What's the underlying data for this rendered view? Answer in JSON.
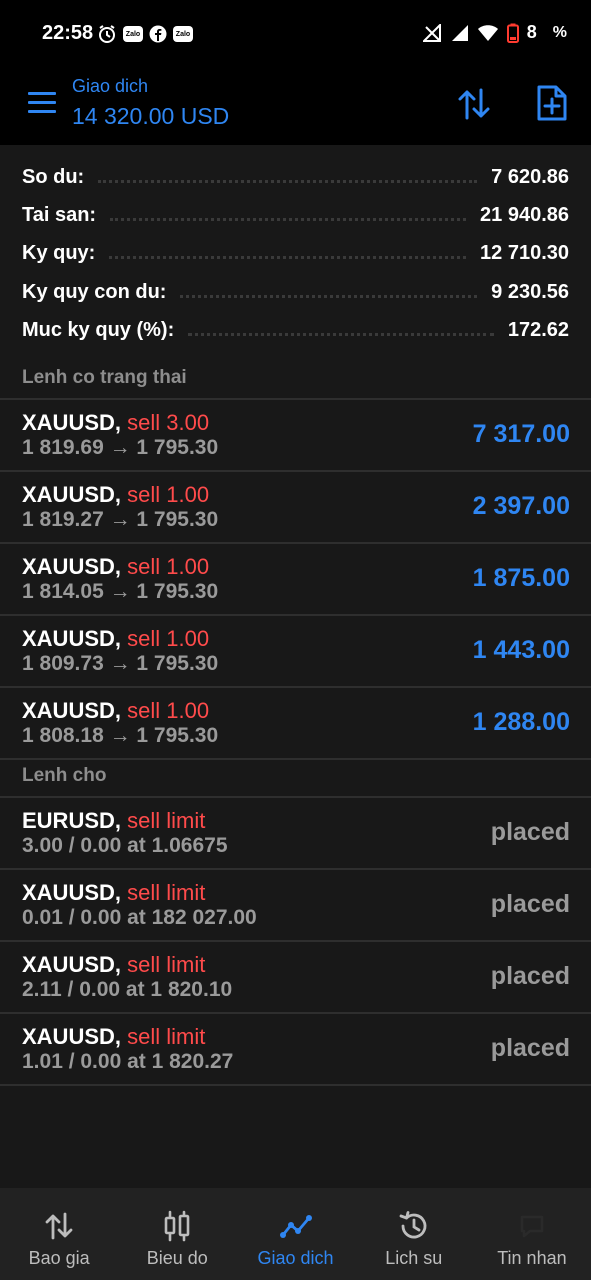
{
  "status_bar": {
    "time": "22:58",
    "battery_level": "8",
    "battery_unit": "%",
    "notif_badges": [
      "Zalo",
      "Zalo"
    ]
  },
  "header": {
    "title": "Giao dich",
    "balance": "14 320.00 USD"
  },
  "summary": [
    {
      "label": "So du:",
      "value": "7 620.86"
    },
    {
      "label": "Tai san:",
      "value": "21 940.86"
    },
    {
      "label": "Ky quy:",
      "value": "12 710.30"
    },
    {
      "label": "Ky quy con du:",
      "value": "9 230.56"
    },
    {
      "label": "Muc ky quy (%):",
      "value": "172.62"
    }
  ],
  "open_section_title": "Lenh co trang thai",
  "open_orders": [
    {
      "symbol": "XAUUSD,",
      "side": "sell 3.00",
      "prices": "1 819.69 → 1 795.30",
      "profit": "7 317.00"
    },
    {
      "symbol": "XAUUSD,",
      "side": "sell 1.00",
      "prices": "1 819.27 → 1 795.30",
      "profit": "2 397.00"
    },
    {
      "symbol": "XAUUSD,",
      "side": "sell 1.00",
      "prices": "1 814.05 → 1 795.30",
      "profit": "1 875.00"
    },
    {
      "symbol": "XAUUSD,",
      "side": "sell 1.00",
      "prices": "1 809.73 → 1 795.30",
      "profit": "1 443.00"
    },
    {
      "symbol": "XAUUSD,",
      "side": "sell 1.00",
      "prices": "1 808.18 → 1 795.30",
      "profit": "1 288.00"
    }
  ],
  "pending_section_title": "Lenh cho",
  "pending_orders": [
    {
      "symbol": "EURUSD,",
      "side": "sell limit",
      "details": "3.00 / 0.00 at 1.06675",
      "state": "placed"
    },
    {
      "symbol": "XAUUSD,",
      "side": "sell limit",
      "details": "0.01 / 0.00 at 182 027.00",
      "state": "placed"
    },
    {
      "symbol": "XAUUSD,",
      "side": "sell limit",
      "details": "2.11 / 0.00 at 1 820.10",
      "state": "placed"
    },
    {
      "symbol": "XAUUSD,",
      "side": "sell limit",
      "details": "1.01 / 0.00 at 1 820.27",
      "state": "placed"
    }
  ],
  "bottom_nav": [
    {
      "label": "Bao gia",
      "icon": "sort-arrows-icon"
    },
    {
      "label": "Bieu do",
      "icon": "candlestick-icon"
    },
    {
      "label": "Giao dich",
      "icon": "trade-line-icon",
      "active": true
    },
    {
      "label": "Lich su",
      "icon": "history-icon"
    },
    {
      "label": "Tin nhan",
      "icon": "message-icon"
    }
  ],
  "colors": {
    "accent": "#2f86f2",
    "sell": "#ff4b4b",
    "background": "#181818",
    "bar": "#000000",
    "muted": "#9a9a9a"
  }
}
